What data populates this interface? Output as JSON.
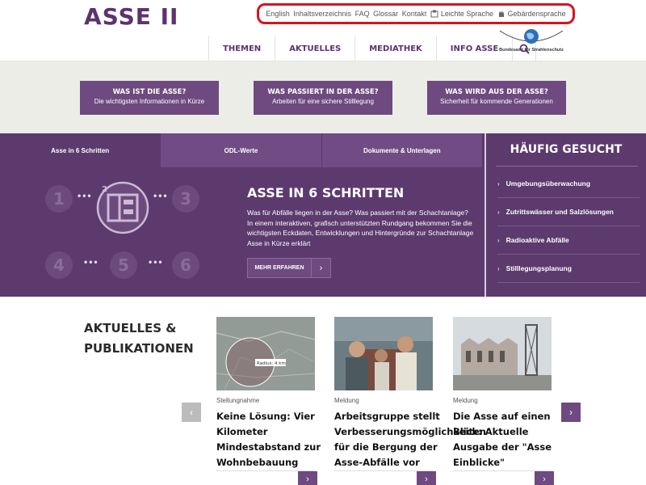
{
  "header": {
    "logo": "ASSE II",
    "service_nav": [
      {
        "label": "English",
        "icon": ""
      },
      {
        "label": "Inhaltsverzeichnis",
        "icon": ""
      },
      {
        "label": "FAQ",
        "icon": ""
      },
      {
        "label": "Glossar",
        "icon": ""
      },
      {
        "label": "Kontakt",
        "icon": ""
      },
      {
        "label": "Leichte Sprache",
        "icon": "easy-language-icon"
      },
      {
        "label": "Gebärdensprache",
        "icon": "sign-language-icon"
      }
    ],
    "main_nav": [
      "THEMEN",
      "AKTUELLES",
      "MEDIATHEK",
      "INFO ASSE"
    ],
    "bfs_logo_text": "Bundesamt für Strahlenschutz",
    "accent_color": "#d7141e"
  },
  "teasers": [
    {
      "title": "WAS IST DIE ASSE?",
      "subtitle": "Die wichtigsten Informationen in Kürze"
    },
    {
      "title": "WAS PASSIERT IN DER ASSE?",
      "subtitle": "Arbeiten für eine sichere Stilllegung"
    },
    {
      "title": "WAS WIRD AUS DER ASSE?",
      "subtitle": "Sicherheit für kommende Generationen"
    }
  ],
  "tabs": [
    "Asse in 6 Schritten",
    "ODL-Werte",
    "Dokumente & Unterlagen"
  ],
  "six_steps": {
    "numbers": [
      "1",
      "2",
      "3",
      "4",
      "5",
      "6"
    ],
    "title": "ASSE IN 6 SCHRITTEN",
    "text": "Was für Abfälle liegen in der Asse? Was passiert mit der Schachtanlage? In einem interaktiven, grafisch unterstützten Rundgang bekommen Sie die wichtigsten Eckdaten, Entwicklungen und Hintergründe zur Schachtanlage Asse in Kürze erklärt",
    "button": "MEHR ERFAHREN"
  },
  "haeufig": {
    "title": "HÄUFIG GESUCHT",
    "items": [
      "Umgebungsüberwachung",
      "Zutrittswässer und Salzlösungen",
      "Radioaktive Abfälle",
      "Stilllegungsplanung"
    ]
  },
  "news": {
    "heading_line1": "AKTUELLES &",
    "heading_line2": "PUBLIKATIONEN",
    "map_label": "Radius: 4 km",
    "items": [
      {
        "category": "Stellungnahme",
        "title": "Keine Lösung: Vier Kilometer Mindestabstand zur Wohnbebauung"
      },
      {
        "category": "Meldung",
        "title": "Arbeitsgruppe stellt Verbesserungsmöglichkeiten für die Bergung der Asse-Abfälle vor"
      },
      {
        "category": "Meldung",
        "title": "Die Asse auf einen Blick: Aktuelle Ausgabe der \"Asse Einblicke\""
      }
    ]
  },
  "colors": {
    "brand_purple": "#5c3a6d",
    "teaser_purple": "#6e4a80",
    "band_bg": "#ecede6"
  }
}
